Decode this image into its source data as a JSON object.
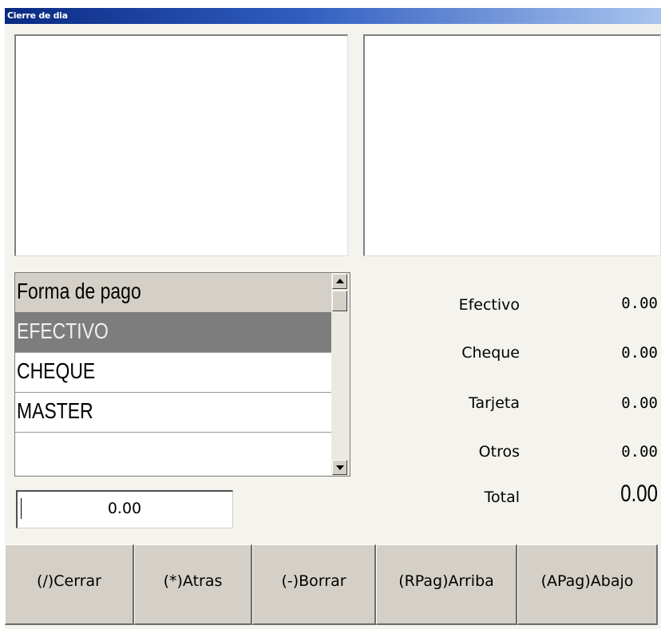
{
  "window": {
    "title": "Cierre de dia"
  },
  "payment_grid": {
    "header": "Forma de pago",
    "rows": [
      "EFECTIVO",
      "CHEQUE",
      "MASTER",
      ""
    ]
  },
  "summary": {
    "rows": [
      {
        "label": "Efectivo",
        "value": "0.00"
      },
      {
        "label": "Cheque",
        "value": "0.00"
      },
      {
        "label": "Tarjeta",
        "value": "0.00"
      },
      {
        "label": "Otros",
        "value": "0.00"
      }
    ],
    "total_label": "Total",
    "total_value": "0.00"
  },
  "amount_input": {
    "value": "0.00"
  },
  "buttons": {
    "cerrar": "(/)Cerrar",
    "atras": "(*)Atras",
    "borrar": "(-)Borrar",
    "arriba": "(RPag)Arriba",
    "abajo": "(APag)Abajo"
  },
  "colors": {
    "titlebar_start": "#0a2a82",
    "titlebar_end": "#a9c4ee",
    "selected_row": "#7d7d7d",
    "button_face": "#d4d0c8"
  }
}
